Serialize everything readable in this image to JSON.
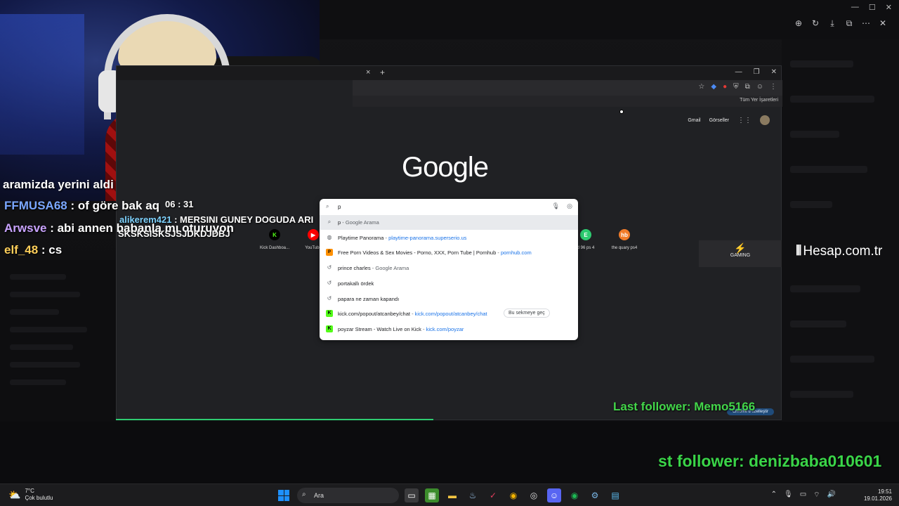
{
  "chat_overlay": [
    {
      "user": "",
      "message": "aramizda yerini aldi",
      "user_color": "#ffffff"
    },
    {
      "user": "FFMUSA68",
      "message": " : of göre bak aq",
      "user_color": "#7aa7ff"
    },
    {
      "user": "Arwsve",
      "message": " : abi annen babanla mı oturuyon",
      "user_color": "#c9a3ff"
    },
    {
      "user": "elf_48",
      "message": " : cs",
      "user_color": "#ffcf5a"
    }
  ],
  "chat_small": [
    {
      "user": "",
      "message": "06 : 31"
    },
    {
      "user": "alikerem421",
      "message": " : MERSINI GUNEY DOGUDA ARI"
    },
    {
      "user": "",
      "message": "SKSKSISKSJSJDKDJDBJ"
    }
  ],
  "viewer_toolbar": [
    "zoom-in-icon",
    "rotate-icon",
    "download-icon",
    "open-external-icon",
    "more-icon",
    "close-icon"
  ],
  "browser": {
    "tab_close": "×",
    "tab_new": "+",
    "bookmarks_all": "Tüm Yer İşaretleri",
    "links": {
      "gmail": "Gmail",
      "images": "Görseller"
    },
    "logo": "Google",
    "shortcuts": [
      {
        "label": "Kick Dashboa...",
        "icon": "K",
        "color": "#53fc18"
      },
      {
        "label": "YouTube",
        "icon": "▶",
        "color": "#ff0000"
      },
      {
        "label": "d 96 ps 4",
        "icon": "E",
        "color": "#2ecc71"
      },
      {
        "label": "the quary ps4",
        "icon": "hb",
        "color": "#f07c2a"
      }
    ],
    "customize": "Chrome'u özelleştir"
  },
  "omnibox": {
    "typed": "p",
    "suggestions": [
      {
        "icon": "search",
        "title": "p",
        "sep": " - ",
        "meta": "Google Arama",
        "url": "",
        "selected": true
      },
      {
        "icon": "globe",
        "title": "Playtime Panorama",
        "sep": " - ",
        "meta": "",
        "url": "playtime-panorama.superserio.us",
        "selected": false
      },
      {
        "icon": "ph",
        "title": "Free Porn Videos & Sex Movies - Porno, XXX, Porn Tube | Pornhub",
        "sep": " - ",
        "meta": "",
        "url": "pornhub.com",
        "selected": false
      },
      {
        "icon": "history",
        "title": "prince charles",
        "sep": " - ",
        "meta": "Google Arama",
        "url": "",
        "selected": false
      },
      {
        "icon": "history",
        "title": "portakallı ördek",
        "sep": "",
        "meta": "",
        "url": "",
        "selected": false
      },
      {
        "icon": "history",
        "title": "papara ne zaman kapandı",
        "sep": "",
        "meta": "",
        "url": "",
        "selected": false
      },
      {
        "icon": "kick",
        "title": "kick.com/popout/atcanbey/chat",
        "sep": " - ",
        "meta": "",
        "url": "kick.com/popout/atcanbey/chat",
        "selected": false,
        "switch_label": "Bu sekmeye geç"
      },
      {
        "icon": "kick",
        "title": "poyzar Stream - Watch Live on Kick",
        "sep": " - ",
        "meta": "",
        "url": "kick.com/poyzar",
        "selected": false
      }
    ]
  },
  "overlays": {
    "gaming_logo": "GAMING",
    "hesap": "Hesap.com.tr",
    "last_follower_1": "Last follower: Memo5166",
    "last_follower_2": "st follower: denizbaba010601"
  },
  "taskbar": {
    "weather_temp": "7°C",
    "weather_desc": "Çok bulutlu",
    "search_placeholder": "Ara",
    "time": "19:51",
    "date": "19.01.2026"
  }
}
